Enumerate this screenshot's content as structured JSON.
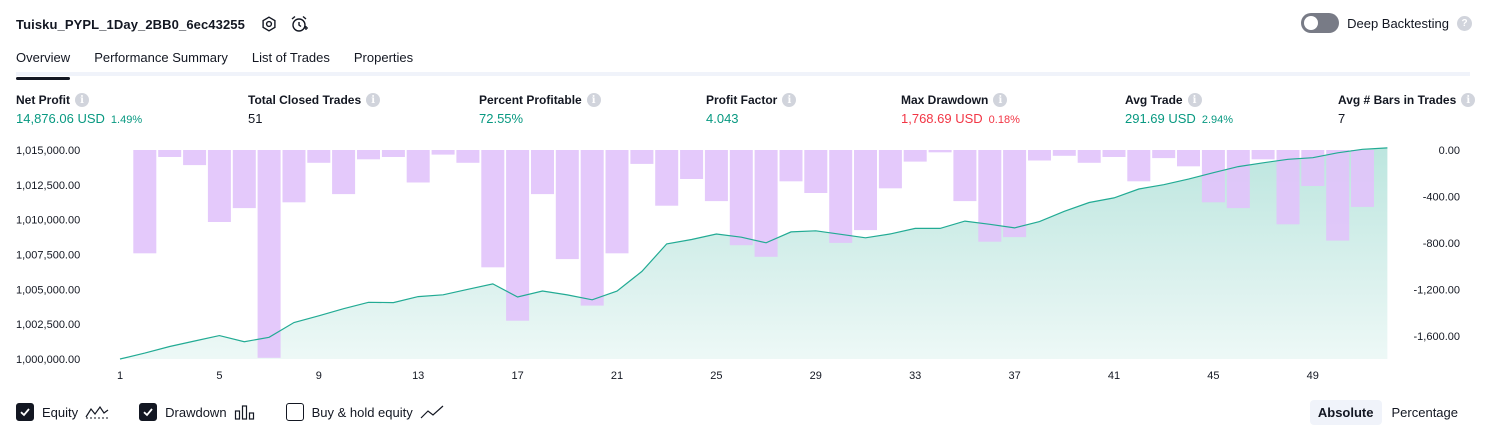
{
  "header": {
    "title": "Tuisku_PYPL_1Day_2BB0_6ec43255",
    "deep_backtesting_label": "Deep Backtesting",
    "deep_backtesting_enabled": false
  },
  "tabs": [
    {
      "label": "Overview",
      "active": true
    },
    {
      "label": "Performance Summary",
      "active": false
    },
    {
      "label": "List of Trades",
      "active": false
    },
    {
      "label": "Properties",
      "active": false
    }
  ],
  "metrics": {
    "net_profit": {
      "label": "Net Profit",
      "value": "14,876.06 USD",
      "pct": "1.49%"
    },
    "total_closed_trades": {
      "label": "Total Closed Trades",
      "value": "51"
    },
    "percent_profitable": {
      "label": "Percent Profitable",
      "value": "72.55%"
    },
    "profit_factor": {
      "label": "Profit Factor",
      "value": "4.043"
    },
    "max_drawdown": {
      "label": "Max Drawdown",
      "value": "1,768.69 USD",
      "pct": "0.18%"
    },
    "avg_trade": {
      "label": "Avg Trade",
      "value": "291.69 USD",
      "pct": "2.94%"
    },
    "avg_bars": {
      "label": "Avg # Bars in Trades",
      "value": "7"
    }
  },
  "colors": {
    "positive": "#089981",
    "negative": "#f23645",
    "equity_line": "#22ab94",
    "drawdown_bar": "#e1c3fb"
  },
  "legend": {
    "equity": {
      "label": "Equity",
      "checked": true
    },
    "drawdown": {
      "label": "Drawdown",
      "checked": true
    },
    "buy_hold": {
      "label": "Buy & hold equity",
      "checked": false
    }
  },
  "mode": {
    "absolute_label": "Absolute",
    "percentage_label": "Percentage",
    "active": "Absolute"
  },
  "chart_data": {
    "type": "area",
    "x": [
      1,
      2,
      3,
      4,
      5,
      6,
      7,
      8,
      9,
      10,
      11,
      12,
      13,
      14,
      15,
      16,
      17,
      18,
      19,
      20,
      21,
      22,
      23,
      24,
      25,
      26,
      27,
      28,
      29,
      30,
      31,
      32,
      33,
      34,
      35,
      36,
      37,
      38,
      39,
      40,
      41,
      42,
      43,
      44,
      45,
      46,
      47,
      48,
      49,
      50,
      51,
      52
    ],
    "x_ticks": [
      1,
      5,
      9,
      13,
      17,
      21,
      25,
      29,
      33,
      37,
      41,
      45,
      49
    ],
    "equity": {
      "name": "Equity",
      "values": [
        1000000,
        1000420,
        1000900,
        1001290,
        1001680,
        1001240,
        1001560,
        1002620,
        1003100,
        1003610,
        1004070,
        1004050,
        1004480,
        1004610,
        1005000,
        1005390,
        1004450,
        1004880,
        1004600,
        1004250,
        1004870,
        1006290,
        1008260,
        1008580,
        1008970,
        1008740,
        1008340,
        1009120,
        1009200,
        1008950,
        1008700,
        1008980,
        1009370,
        1009370,
        1009900,
        1009670,
        1009410,
        1009860,
        1010600,
        1011230,
        1011560,
        1012200,
        1012510,
        1012910,
        1013370,
        1013810,
        1014080,
        1014330,
        1014450,
        1014800,
        1015050,
        1015150
      ]
    },
    "drawdown": {
      "name": "Drawdown",
      "values": [
        0,
        -890,
        -60,
        -130,
        -620,
        -500,
        -1790,
        -450,
        -110,
        -380,
        -80,
        -60,
        -280,
        -40,
        -110,
        -1010,
        -1470,
        -380,
        -940,
        -1340,
        -890,
        -120,
        -480,
        -250,
        -440,
        -820,
        -920,
        -270,
        -370,
        -800,
        -690,
        -330,
        -100,
        -20,
        -440,
        -790,
        -750,
        -90,
        -50,
        -110,
        -60,
        -270,
        -70,
        -140,
        -450,
        -500,
        -80,
        -640,
        -310,
        -780,
        -490,
        0
      ]
    },
    "left_axis": {
      "ticks": [
        "1,000,000.00",
        "1,002,500.00",
        "1,005,000.00",
        "1,007,500.00",
        "1,010,000.00",
        "1,012,500.00",
        "1,015,000.00"
      ],
      "range": [
        1000000,
        1015000
      ]
    },
    "right_axis": {
      "ticks": [
        "0.00",
        "-400.00",
        "-800.00",
        "-1,200.00",
        "-1,600.00"
      ],
      "range": [
        -1800,
        0
      ]
    }
  }
}
